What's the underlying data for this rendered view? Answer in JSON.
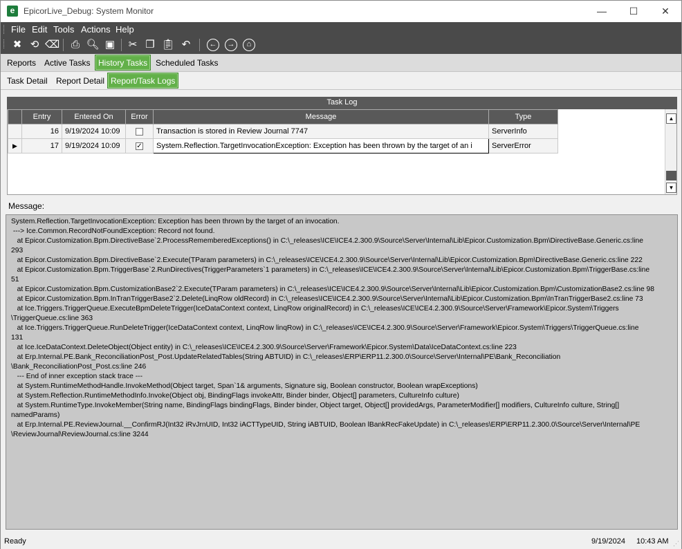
{
  "window": {
    "title": "EpicorLive_Debug: System Monitor",
    "app_icon_glyph": "e",
    "controls": [
      "—",
      "☐",
      "✕"
    ]
  },
  "menu": [
    "File",
    "Edit",
    "Tools",
    "Actions",
    "Help"
  ],
  "toolbar_icons": [
    "close-icon",
    "refresh-icon",
    "clear-icon",
    "print-icon",
    "print-preview-icon",
    "save-icon",
    "cut-icon",
    "copy-icon",
    "paste-icon",
    "undo-icon",
    "back-icon",
    "forward-icon",
    "home-icon"
  ],
  "tabs_primary": [
    "Reports",
    "Active Tasks",
    "History Tasks",
    "Scheduled Tasks"
  ],
  "tabs_primary_active": "History Tasks",
  "tabs_secondary": [
    "Task Detail",
    "Report Detail",
    "Report/Task Logs"
  ],
  "tabs_secondary_active": "Report/Task Logs",
  "task_log": {
    "header": "Task Log",
    "columns": [
      "Entry",
      "Entered On",
      "Error",
      "Message",
      "Type"
    ],
    "rows": [
      {
        "entry": "16",
        "entered_on": "9/19/2024 10:09",
        "error": false,
        "message": "Transaction is stored in Review Journal 7747",
        "type": "ServerInfo",
        "current": false
      },
      {
        "entry": "17",
        "entered_on": "9/19/2024 10:09",
        "error": true,
        "message": "System.Reflection.TargetInvocationException: Exception has been thrown by the target of an i",
        "type": "ServerError",
        "current": true
      }
    ]
  },
  "message_label": "Message:",
  "message_text": "System.Reflection.TargetInvocationException: Exception has been thrown by the target of an invocation.\n ---> Ice.Common.RecordNotFoundException: Record not found.\n   at Epicor.Customization.Bpm.DirectiveBase`2.ProcessRememberedExceptions() in C:\\_releases\\ICE\\ICE4.2.300.9\\Source\\Server\\Internal\\Lib\\Epicor.Customization.Bpm\\DirectiveBase.Generic.cs:line\n293\n   at Epicor.Customization.Bpm.DirectiveBase`2.Execute(TParam parameters) in C:\\_releases\\ICE\\ICE4.2.300.9\\Source\\Server\\Internal\\Lib\\Epicor.Customization.Bpm\\DirectiveBase.Generic.cs:line 222\n   at Epicor.Customization.Bpm.TriggerBase`2.RunDirectives(TriggerParameters`1 parameters) in C:\\_releases\\ICE\\ICE4.2.300.9\\Source\\Server\\Internal\\Lib\\Epicor.Customization.Bpm\\TriggerBase.cs:line\n51\n   at Epicor.Customization.Bpm.CustomizationBase2`2.Execute(TParam parameters) in C:\\_releases\\ICE\\ICE4.2.300.9\\Source\\Server\\Internal\\Lib\\Epicor.Customization.Bpm\\CustomizationBase2.cs:line 98\n   at Epicor.Customization.Bpm.InTranTriggerBase2`2.Delete(LinqRow oldRecord) in C:\\_releases\\ICE\\ICE4.2.300.9\\Source\\Server\\Internal\\Lib\\Epicor.Customization.Bpm\\InTranTriggerBase2.cs:line 73\n   at Ice.Triggers.TriggerQueue.ExecuteBpmDeleteTrigger(IceDataContext context, LinqRow originalRecord) in C:\\_releases\\ICE\\ICE4.2.300.9\\Source\\Server\\Framework\\Epicor.System\\Triggers\n\\TriggerQueue.cs:line 363\n   at Ice.Triggers.TriggerQueue.RunDeleteTrigger(IceDataContext context, LinqRow linqRow) in C:\\_releases\\ICE\\ICE4.2.300.9\\Source\\Server\\Framework\\Epicor.System\\Triggers\\TriggerQueue.cs:line\n131\n   at Ice.IceDataContext.DeleteObject(Object entity) in C:\\_releases\\ICE\\ICE4.2.300.9\\Source\\Server\\Framework\\Epicor.System\\Data\\IceDataContext.cs:line 223\n   at Erp.Internal.PE.Bank_ReconciliationPost_Post.UpdateRelatedTables(String ABTUID) in C:\\_releases\\ERP\\ERP11.2.300.0\\Source\\Server\\Internal\\PE\\Bank_Reconciliation\n\\Bank_ReconciliationPost_Post.cs:line 246\n   --- End of inner exception stack trace ---\n   at System.RuntimeMethodHandle.InvokeMethod(Object target, Span`1& arguments, Signature sig, Boolean constructor, Boolean wrapExceptions)\n   at System.Reflection.RuntimeMethodInfo.Invoke(Object obj, BindingFlags invokeAttr, Binder binder, Object[] parameters, CultureInfo culture)\n   at System.RuntimeType.InvokeMember(String name, BindingFlags bindingFlags, Binder binder, Object target, Object[] providedArgs, ParameterModifier[] modifiers, CultureInfo culture, String[]\nnamedParams)\n   at Erp.Internal.PE.ReviewJournal.__ConfirmRJ(Int32 iRvJrnUID, Int32 iACTTypeUID, String iABTUID, Boolean lBankRecFakeUpdate) in C:\\_releases\\ERP\\ERP11.2.300.0\\Source\\Server\\Internal\\PE\n\\ReviewJournal\\ReviewJournal.cs:line 3244",
  "status": {
    "text": "Ready",
    "date": "9/19/2024",
    "time": "10:43 AM"
  },
  "colors": {
    "dark_bar": "#4a4a4a",
    "tab_active": "#62b049",
    "grid_header": "#595959",
    "message_bg": "#c8c8c8"
  }
}
